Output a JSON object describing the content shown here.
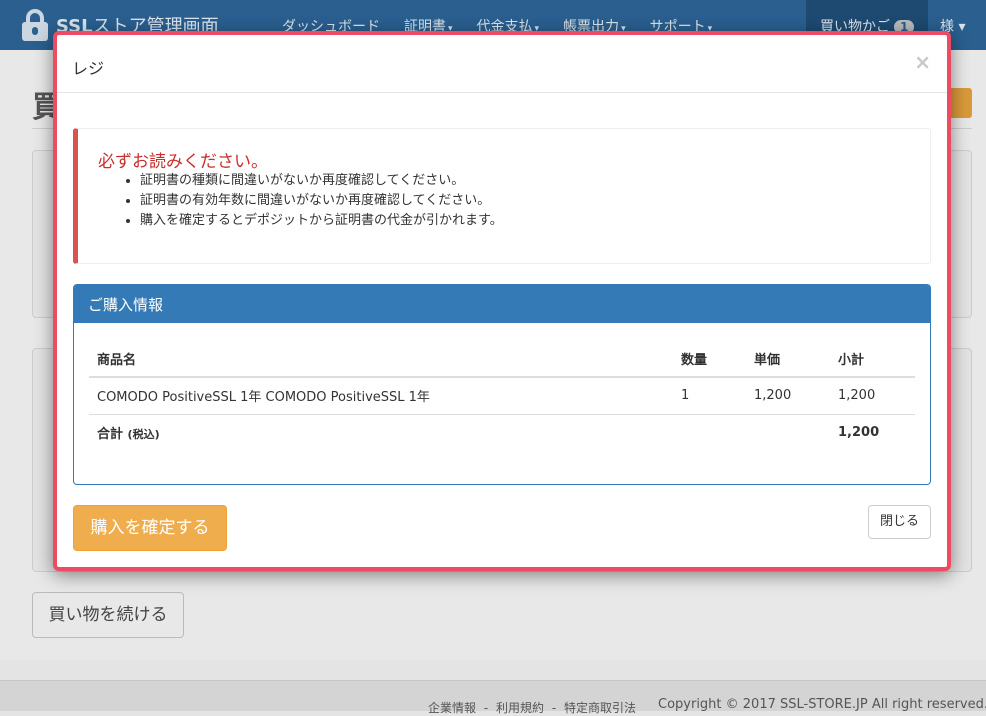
{
  "navbar": {
    "brand_bold": "SSL",
    "brand_rest": "ストア管理画面",
    "items": [
      {
        "label": "ダッシュボード",
        "has_caret": false
      },
      {
        "label": "証明書",
        "has_caret": true
      },
      {
        "label": "代金支払",
        "has_caret": true
      },
      {
        "label": "帳票出力",
        "has_caret": true
      },
      {
        "label": "サポート",
        "has_caret": true
      }
    ],
    "cart_label": "買い物かご",
    "cart_count": "1",
    "user_label": "様",
    "caret_glyph": "▾"
  },
  "background": {
    "page_title": "買",
    "continue_button": "買い物を続ける"
  },
  "footer": {
    "links": [
      "企業情報",
      "-",
      "利用規約",
      "-",
      "特定商取引法"
    ],
    "copyright": "Copyright © 2017 SSL-STORE.JP All right reserved."
  },
  "modal": {
    "title": "レジ",
    "close_glyph": "×",
    "notice": {
      "title": "必ずお読みください。",
      "items": [
        "証明書の種類に間違いがないか再度確認してください。",
        "証明書の有効年数に間違いがないか再度確認してください。",
        "購入を確定するとデポジットから証明書の代金が引かれます。"
      ]
    },
    "purchase_info": {
      "heading": "ご購入情報",
      "columns": [
        "商品名",
        "数量",
        "単価",
        "小計"
      ],
      "rows": [
        {
          "name": "COMODO PositiveSSL 1年 COMODO PositiveSSL 1年",
          "qty": "1",
          "unit_price": "1,200",
          "subtotal": "1,200"
        }
      ],
      "total_label": "合計",
      "total_note": "(税込)",
      "total_value": "1,200"
    },
    "confirm_button": "購入を確定する",
    "close_button": "閉じる"
  },
  "colors": {
    "navbar": "#2a5f8f",
    "modal_border": "#ee4a62",
    "panel_primary": "#337ab7",
    "warning_button": "#f0ad4e",
    "danger_text": "#c9302c"
  }
}
